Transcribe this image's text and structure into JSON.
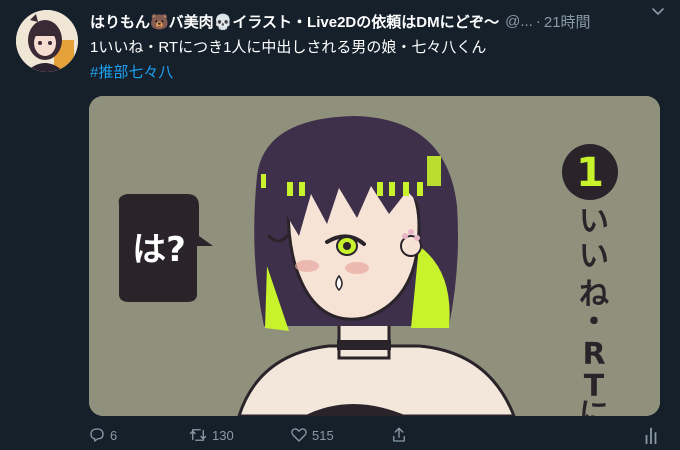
{
  "tweet": {
    "display_name": "はりもん🐻バ美肉💀イラスト・Live2Dの依頼はDMにどぞ〜",
    "handle": "@...",
    "separator": "·",
    "time": "21時間",
    "text": "1いいね・RTにつき1人に中出しされる男の娘・七々八くん",
    "hashtag": "#推部七々八"
  },
  "media": {
    "speech_bubble_text": "は?",
    "side_number": "1",
    "side_text": [
      "い",
      "い",
      "ね",
      "・",
      "R",
      "T",
      "に"
    ]
  },
  "actions": {
    "replies": "6",
    "retweets": "130",
    "likes": "515"
  },
  "colors": {
    "background": "#15202b",
    "secondary_text": "#8899a6",
    "link": "#1da1f2",
    "hair_highlight": "#c8f22c"
  },
  "icons": [
    "reply-icon",
    "retweet-icon",
    "like-icon",
    "share-icon",
    "analytics-icon",
    "chevron-down-icon"
  ]
}
